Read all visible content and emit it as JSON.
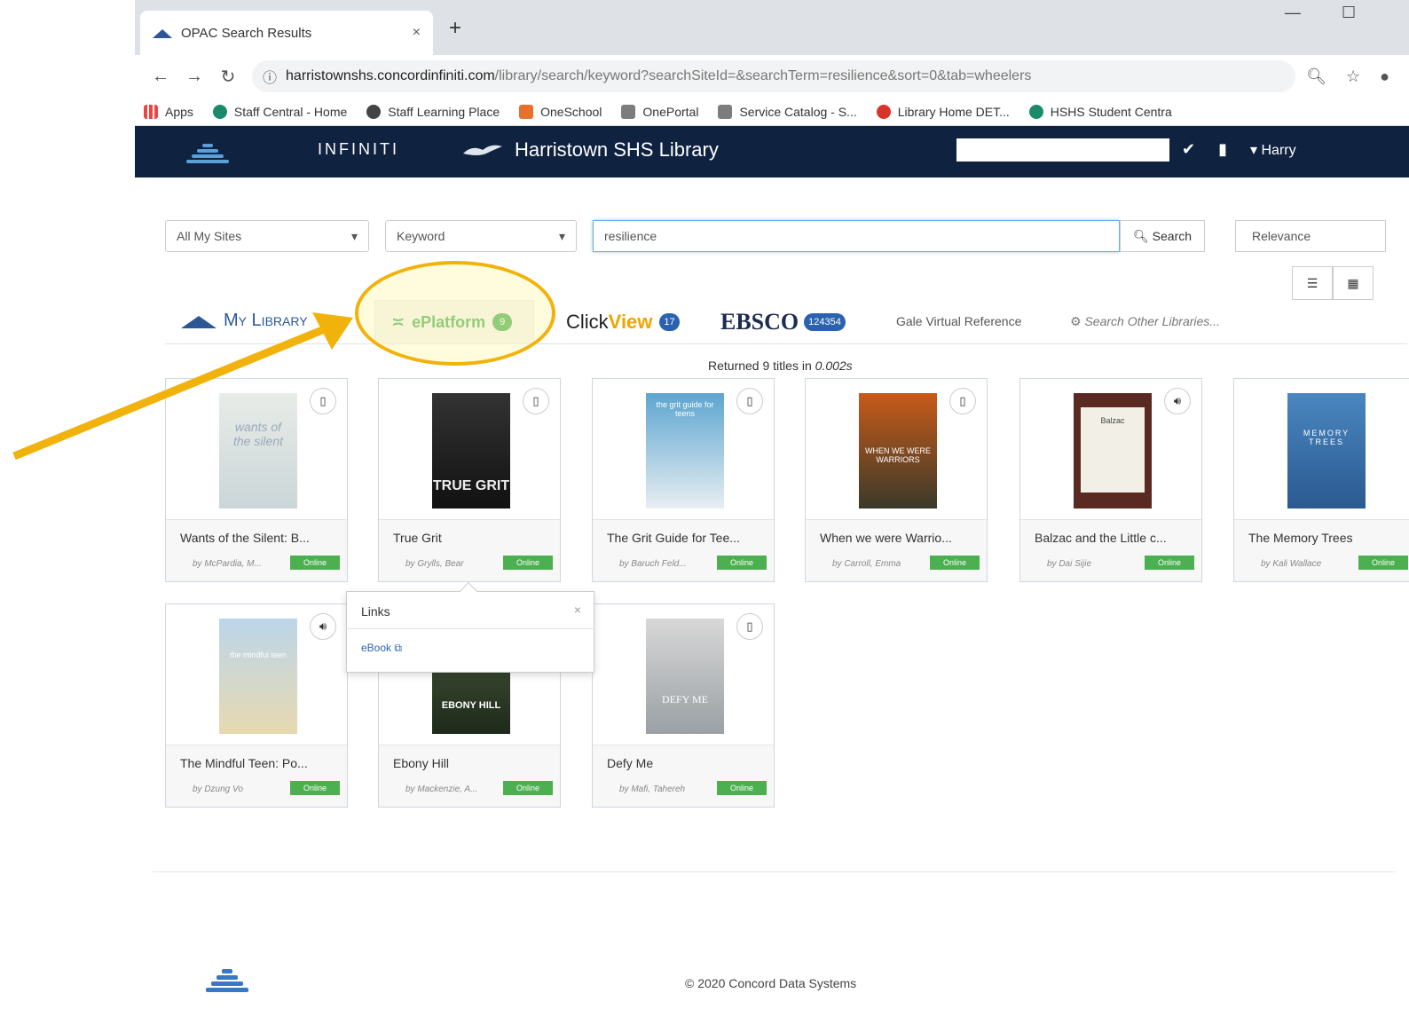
{
  "browser": {
    "tab_title": "OPAC Search Results",
    "tab_close": "×",
    "new_tab": "+",
    "url_host": "harristownshs.concordinfiniti.com",
    "url_path": "/library/search/keyword?searchSiteId=&searchTerm=resilience&sort=0&tab=wheelers",
    "bookmarks": [
      "Apps",
      "Staff Central - Home",
      "Staff Learning Place",
      "OneSchool",
      "OnePortal",
      "Service Catalog - S...",
      "Library Home DET...",
      "HSHS Student Centra"
    ]
  },
  "app": {
    "brand": "INFINITI",
    "library_name": "Harristown SHS Library",
    "user": "Harry"
  },
  "search": {
    "site_select": "All My Sites",
    "type_select": "Keyword",
    "query": "resilience",
    "button": "Search",
    "sort_select": "Relevance"
  },
  "tabs": {
    "mylib": "My Library",
    "eplatform": "ePlatform",
    "eplatform_count": "9",
    "clickview_a": "Click",
    "clickview_b": "View",
    "clickview_count": "17",
    "ebsco": "EBSCO",
    "ebsco_count": "124354",
    "gale": "Gale Virtual Reference",
    "other": "Search Other Libraries..."
  },
  "returned": {
    "prefix": "Returned ",
    "count": "9",
    "mid": " titles in ",
    "time": "0.002s"
  },
  "books": [
    {
      "title": "Wants of the Silent: B...",
      "author": "by McPardia, M...",
      "online": "Online",
      "cover_text": "wants of the silent"
    },
    {
      "title": "True Grit",
      "author": "by Grylls, Bear",
      "online": "Online",
      "cover_text": "TRUE GRIT"
    },
    {
      "title": "The Grit Guide for Tee...",
      "author": "by Baruch Feld...",
      "online": "Online",
      "cover_text": "the grit guide for teens"
    },
    {
      "title": "When we were Warrio...",
      "author": "by Carroll, Emma",
      "online": "Online",
      "cover_text": "WHEN WE WERE WARRIORS"
    },
    {
      "title": "Balzac and the Little c...",
      "author": "by Dai Sijie",
      "online": "Online",
      "cover_text": "Balzac"
    },
    {
      "title": "The Memory Trees",
      "author": "by Kali Wallace",
      "online": "Online",
      "cover_text": "MEMORY TREES"
    },
    {
      "title": "The Mindful Teen: Po...",
      "author": "by Dzung Vo",
      "online": "Online",
      "cover_text": "the mindful teen"
    },
    {
      "title": "Ebony Hill",
      "author": "by Mackenzie, A...",
      "online": "Online",
      "cover_text": "EBONY HILL"
    },
    {
      "title": "Defy Me",
      "author": "by Mafi, Tahereh",
      "online": "Online",
      "cover_text": "DEFY ME"
    }
  ],
  "popover": {
    "title": "Links",
    "close": "×",
    "link": "eBook"
  },
  "footer": {
    "copyright": "© 2020 Concord Data Systems"
  },
  "colors": {
    "nav": "#0f2240",
    "accent": "#3aa84a",
    "annotation": "#f2b20c"
  }
}
